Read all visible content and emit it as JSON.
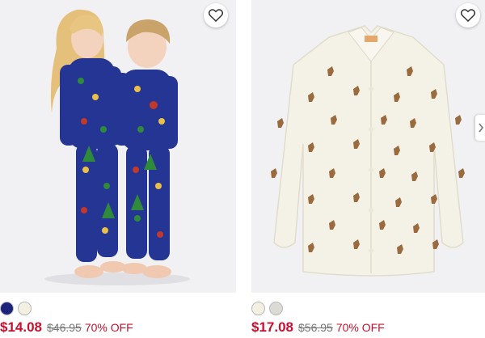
{
  "products": [
    {
      "image_alt": "Kids holiday pajamas",
      "swatches": [
        "#1d237a",
        "#f4f0e1"
      ],
      "sale_price": "$14.08",
      "original_price": "$46.95",
      "discount": "70% OFF",
      "favorite_icon": "heart-outline-icon"
    },
    {
      "image_alt": "Reindeer button-up shirt",
      "swatches": [
        "#f4f0e1",
        "#dcdad4"
      ],
      "sale_price": "$17.08",
      "original_price": "$56.95",
      "discount": "70% OFF",
      "favorite_icon": "heart-outline-icon"
    }
  ],
  "colors": {
    "sale_red": "#c8102e",
    "pajama_navy": "#253593",
    "shirt_cream": "#f4f1e6",
    "reindeer_brown": "#9a6b3f"
  }
}
